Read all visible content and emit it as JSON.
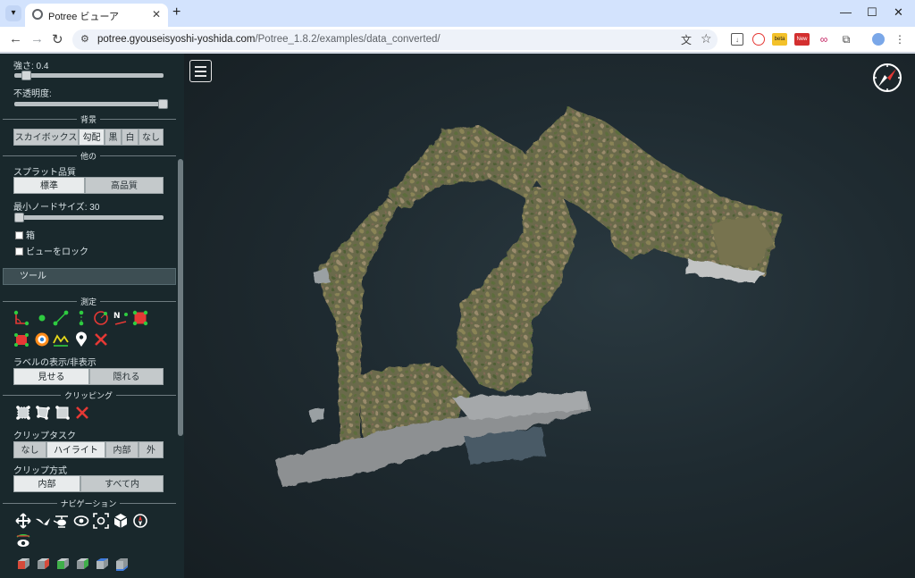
{
  "browser": {
    "tab_title": "Potree ビューア",
    "url_host": "potree.gyouseisyoshi-yoshida.com",
    "url_path": "/Potree_1.8.2/examples/data_converted/",
    "ext_beta": "beta",
    "ext_new": "New"
  },
  "sidebar": {
    "strength_label": "強さ: 0.4",
    "strength_value": 0.4,
    "opacity_label": "不透明度:",
    "opacity_value": 1.0,
    "background_title": "背景",
    "background_options": [
      "スカイボックス",
      "勾配",
      "黒",
      "白",
      "なし"
    ],
    "background_selected": "勾配",
    "other_title": "他の",
    "splat_label": "スプラット品質",
    "splat_options": [
      "標準",
      "高品質"
    ],
    "splat_selected": "標準",
    "min_node_label": "最小ノードサイズ: 30",
    "min_node_value": 30,
    "box_label": "箱",
    "lock_view_label": "ビューをロック",
    "tools_label": "ツール",
    "measure_title": "測定",
    "label_toggle_label": "ラベルの表示/非表示",
    "label_options": [
      "見せる",
      "隠れる"
    ],
    "label_selected": "見せる",
    "clipping_title": "クリッピング",
    "clip_task_label": "クリップタスク",
    "clip_task_options": [
      "なし",
      "ハイライト",
      "内部",
      "外"
    ],
    "clip_task_selected": "ハイライト",
    "clip_method_label": "クリップ方式",
    "clip_method_options": [
      "内部",
      "すべて内"
    ],
    "clip_method_selected": "内部",
    "navigation_title": "ナビゲーション",
    "measure_icon_labels": [
      "N"
    ]
  },
  "viewer": {
    "background": "gradient"
  },
  "colors": {
    "sidebar_bg": "#19282c",
    "viewer_bg": "#1f2b31",
    "accent_red": "#e53935",
    "accent_green": "#2ecc40"
  }
}
